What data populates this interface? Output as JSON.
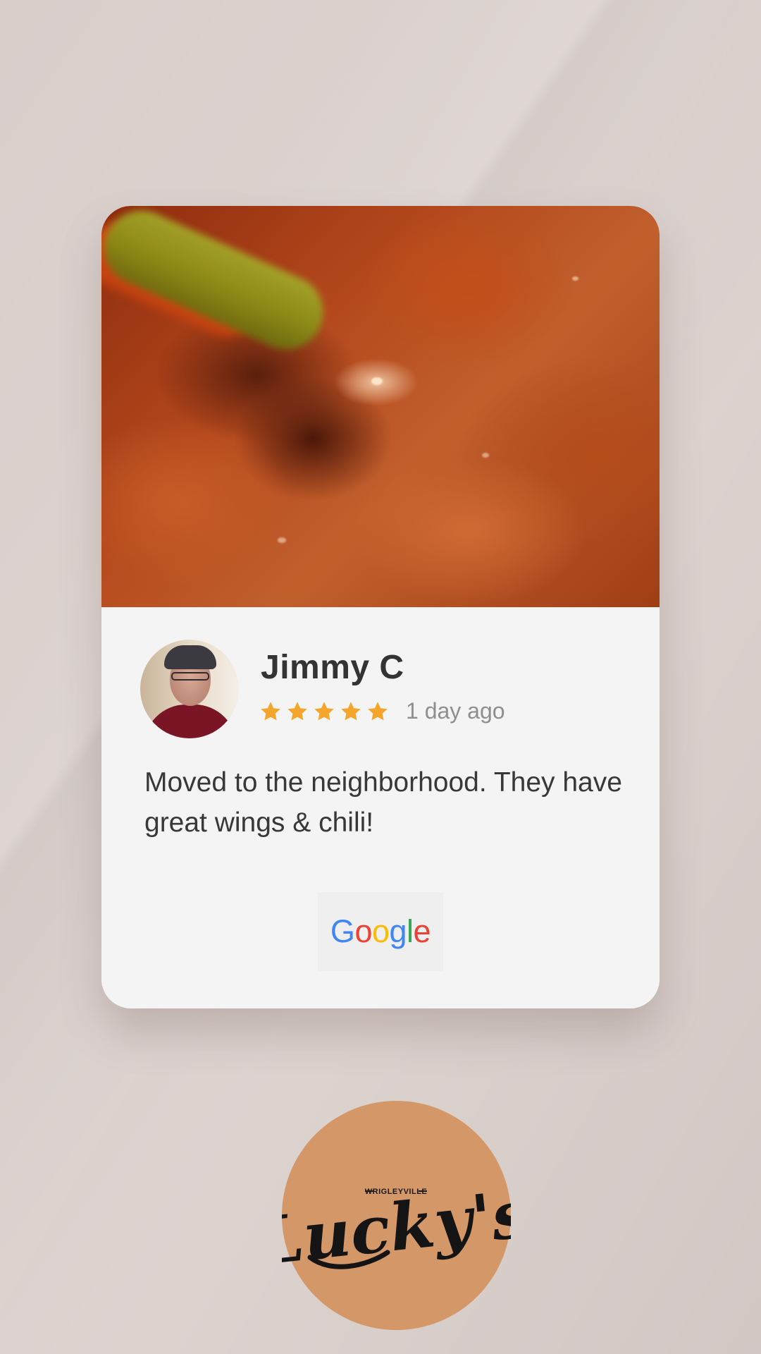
{
  "review": {
    "reviewer_name": "Jimmy C",
    "rating": 5,
    "rating_max": 5,
    "time_ago": "1 day ago",
    "text": "Moved to the neighborhood. They have great wings & chili!",
    "source": "Google",
    "star_color": "#f4a52c"
  },
  "google_logo": {
    "letters": [
      {
        "char": "G",
        "color": "#4285f4"
      },
      {
        "char": "o",
        "color": "#ea4335"
      },
      {
        "char": "o",
        "color": "#fbbc05"
      },
      {
        "char": "g",
        "color": "#4285f4"
      },
      {
        "char": "l",
        "color": "#34a853"
      },
      {
        "char": "e",
        "color": "#ea4335"
      }
    ]
  },
  "brand": {
    "name": "Lucky's",
    "tagline": "WRIGLEYVILLE",
    "badge_color": "#d49767"
  }
}
